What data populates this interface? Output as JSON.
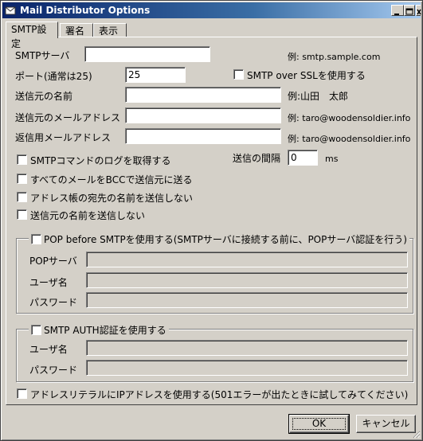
{
  "window": {
    "title": "Mail Distributor Options",
    "controls": [
      "minimize-icon",
      "maximize-icon",
      "close-icon"
    ]
  },
  "tabs": [
    {
      "label": "SMTP設定",
      "active": true
    },
    {
      "label": "署名",
      "active": false
    },
    {
      "label": "表示",
      "active": false
    }
  ],
  "smtp": {
    "server_label": "SMTPサーバ",
    "server_value": "",
    "server_example": "例: smtp.sample.com",
    "port_label": "ポート(通常は25)",
    "port_value": "25",
    "ssl_label": "SMTP over SSLを使用する",
    "sender_name_label": "送信元の名前",
    "sender_name_value": "",
    "sender_name_example": "例:山田　太郎",
    "sender_addr_label": "送信元のメールアドレス",
    "sender_addr_value": "",
    "sender_addr_example": "例: taro@woodensoldier.info",
    "reply_addr_label": "返信用メールアドレス",
    "reply_addr_value": "",
    "reply_addr_example": "例: taro@woodensoldier.info",
    "interval_label": "送信の間隔",
    "interval_value": "0",
    "interval_unit": "ms"
  },
  "options": {
    "log_label": "SMTPコマンドのログを取得する",
    "bcc_label": "すべてのメールをBCCで送信元に送る",
    "no_addressbook_name_label": "アドレス帳の宛先の名前を送信しない",
    "no_sender_name_label": "送信元の名前を送信しない"
  },
  "pop": {
    "legend": "POP before SMTPを使用する(SMTPサーバに接続する前に、POPサーバ認証を行う)",
    "server_label": "POPサーバ",
    "server_value": "",
    "user_label": "ユーザ名",
    "user_value": "",
    "password_label": "パスワード",
    "password_value": ""
  },
  "auth": {
    "legend": "SMTP AUTH認証を使用する",
    "user_label": "ユーザ名",
    "user_value": "",
    "password_label": "パスワード",
    "password_value": ""
  },
  "ip_literal_label": "アドレスリテラルにIPアドレスを使用する(501エラーが出たときに試してみてください)",
  "buttons": {
    "ok": "OK",
    "cancel": "キャンセル"
  }
}
